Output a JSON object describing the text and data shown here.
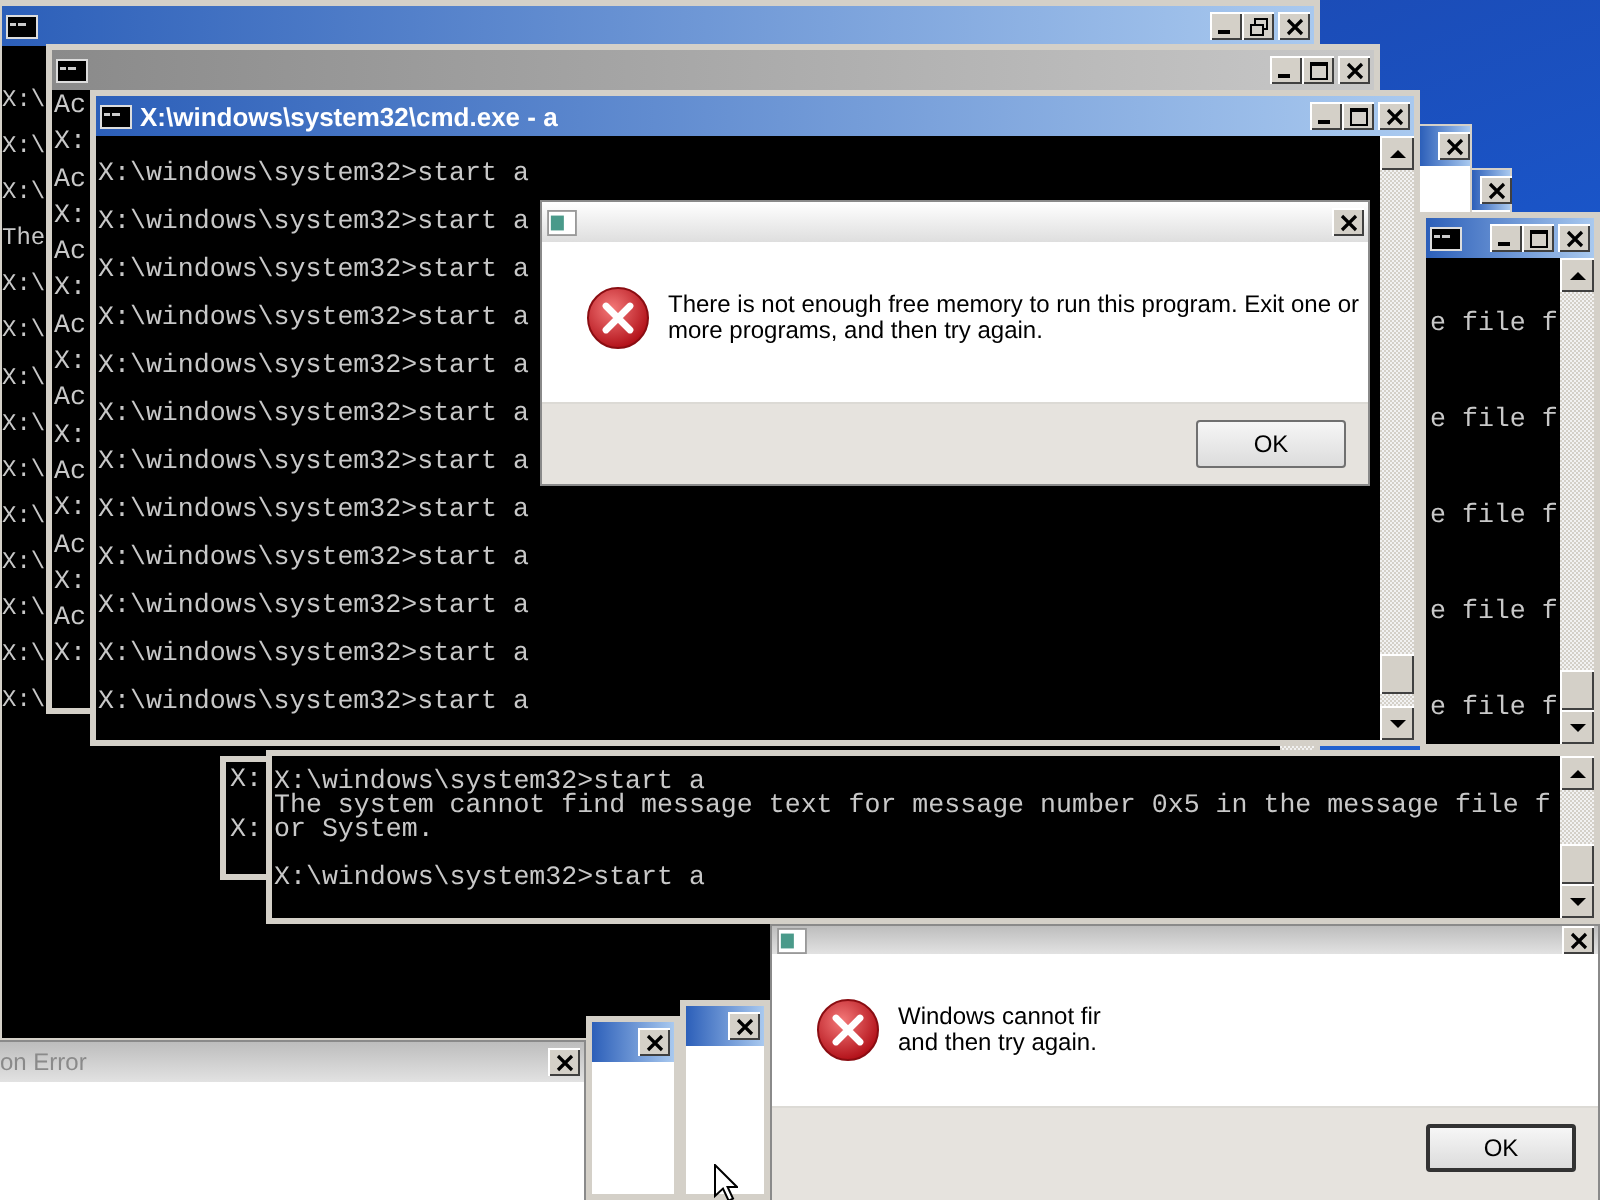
{
  "windows": [
    {
      "kind": "console",
      "active": true,
      "maximized": true,
      "blocks": [
        [
          "X:\\"
        ],
        [
          "X:\\"
        ],
        [
          "X:\\"
        ],
        [
          "The"
        ],
        [
          "X:\\"
        ],
        [
          "X:\\"
        ],
        [
          "X:\\"
        ],
        [
          "X:\\"
        ],
        [
          "X:\\"
        ],
        [
          "X:\\"
        ],
        [
          "X:\\"
        ],
        [
          "X:\\"
        ],
        [
          "X:\\"
        ],
        [
          "X:\\"
        ]
      ]
    },
    {
      "kind": "console",
      "active": false,
      "maximized": false,
      "blocks": [
        [
          "Ac"
        ],
        [
          "X:"
        ],
        [
          "Ac"
        ],
        [
          "X:"
        ],
        [
          "Ac"
        ],
        [
          "X:"
        ],
        [
          "Ac"
        ],
        [
          "X:"
        ],
        [
          "Ac"
        ],
        [
          "X:"
        ],
        [
          "Ac"
        ],
        [
          "X:"
        ],
        [
          "Ac"
        ],
        [
          "X:"
        ],
        [
          "Ac"
        ],
        [
          "X:"
        ]
      ]
    },
    {
      "kind": "console",
      "active": true,
      "maximized": false,
      "title": "X:\\windows\\system32\\cmd.exe - a",
      "blocks": [
        [
          "X:\\windows\\system32>start a"
        ],
        [
          "X:\\windows\\system32>start a"
        ],
        [
          "X:\\windows\\system32>start a"
        ],
        [
          "X:\\windows\\system32>start a"
        ],
        [
          "X:\\windows\\system32>start a"
        ],
        [
          "X:\\windows\\system32>start a"
        ],
        [
          "X:\\windows\\system32>start a"
        ],
        [
          "X:\\windows\\system32>start a"
        ],
        [
          "X:\\windows\\system32>start a"
        ],
        [
          "X:\\windows\\system32>start a"
        ],
        [
          "X:\\windows\\system32>start a"
        ],
        [
          "X:\\windows\\system32>start a"
        ]
      ]
    },
    {
      "kind": "error_dialog",
      "active": true,
      "message": "There is not enough free memory to run this program. Exit one or\nmore programs, and then try again.",
      "button": "OK"
    },
    {
      "kind": "frame",
      "active": true
    },
    {
      "kind": "frame",
      "active": true
    },
    {
      "kind": "console",
      "active": true,
      "maximized": false,
      "blocks": [
        [
          "e file f"
        ],
        [
          "e file f"
        ],
        [
          "e file f"
        ],
        [
          "e file f"
        ],
        [
          "e file f"
        ]
      ]
    },
    {
      "kind": "pane",
      "blocks": [
        [
          "X:"
        ],
        [
          "X:"
        ]
      ]
    },
    {
      "kind": "pane",
      "blocks": [
        [
          "X:\\windows\\system32>start a",
          "The system cannot find message text for message number 0x5 in the message file f",
          "or System."
        ],
        [
          "X:\\windows\\system32>start a"
        ]
      ]
    },
    {
      "kind": "error_dialog",
      "active": false,
      "message": "Windows cannot fir\nand then try again.",
      "button": "OK"
    },
    {
      "kind": "frame",
      "active": true
    },
    {
      "kind": "frame",
      "active": true
    },
    {
      "kind": "dialog",
      "active": false,
      "title": "on Error"
    }
  ]
}
